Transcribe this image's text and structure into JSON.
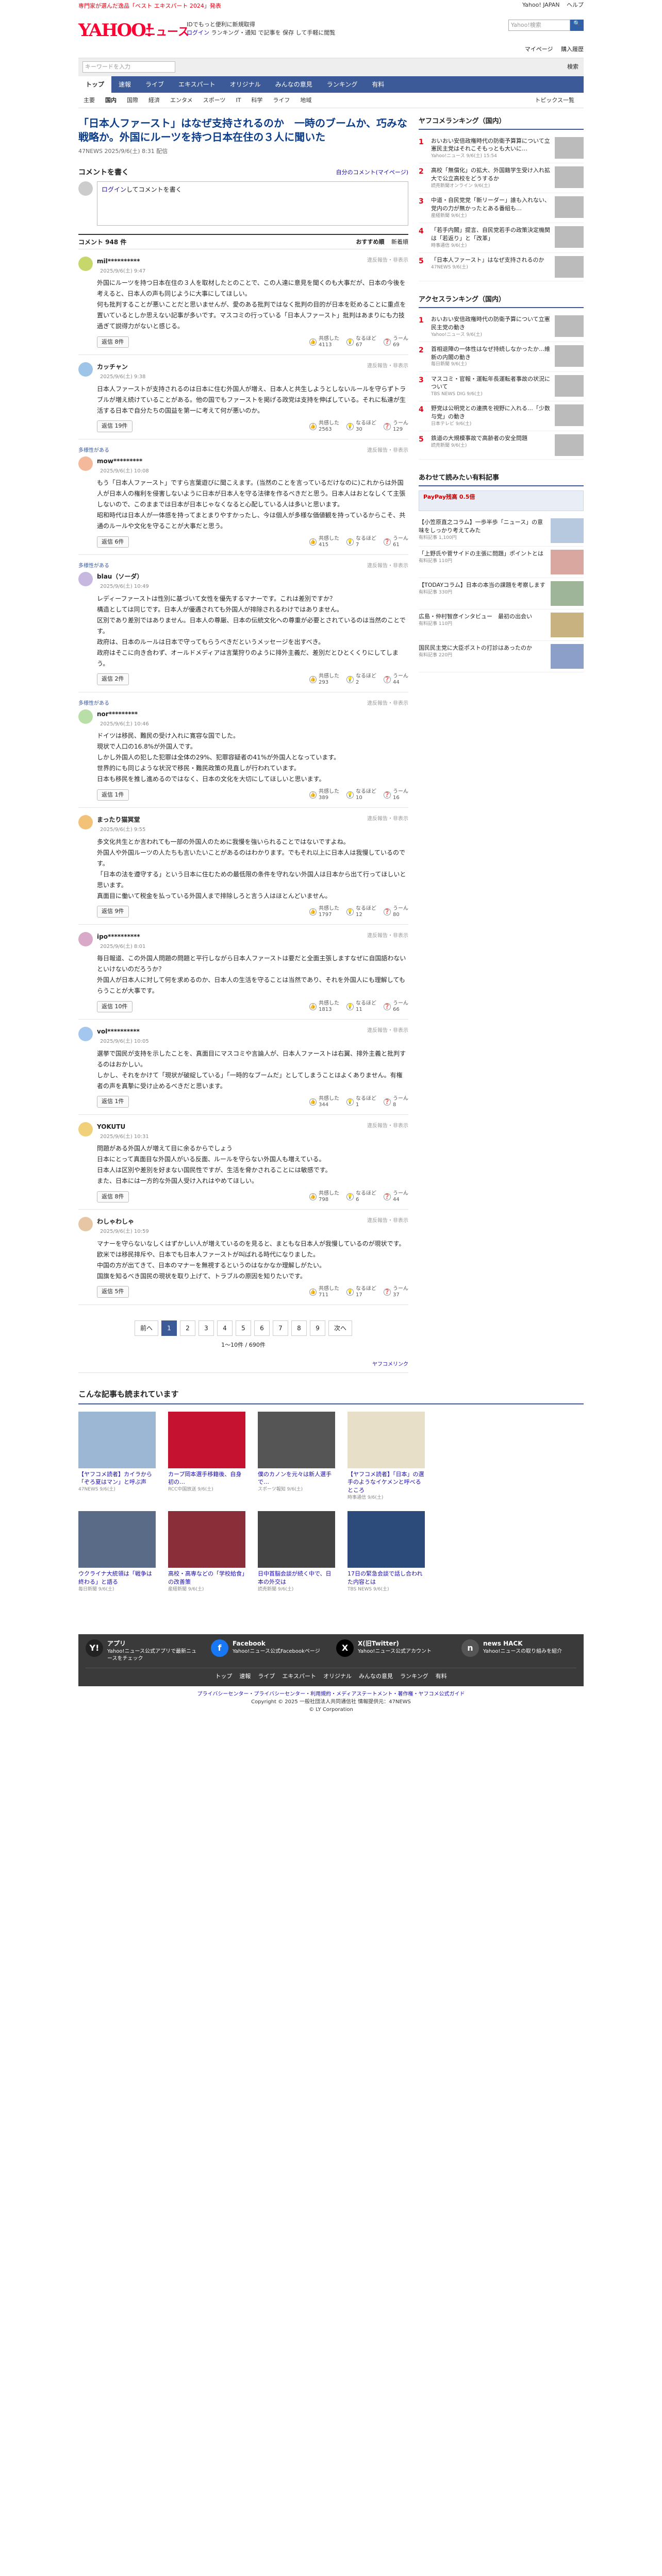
{
  "topbar": {
    "promo": "専門家が選んだ逸品「ベスト エキスパート 2024」発表",
    "links": [
      "Yahoo! JAPAN",
      "ヘルプ"
    ]
  },
  "header": {
    "logo": "YAHOO!",
    "logo_sub": "ニュース",
    "tagline": "IDでもっと便利に新規取得",
    "login": "ログイン",
    "login_note": "ランキング・通知 で記事を 保存 して手軽に閲覧",
    "search_placeholder": "Yahoo!検索",
    "mypage": "マイページ",
    "purchase": "購入履歴",
    "search_btn": "🔍"
  },
  "searchrow": {
    "placeholder": "キーワードを入力",
    "right_label": "検索"
  },
  "gnav": [
    "トップ",
    "速報",
    "ライブ",
    "エキスパート",
    "オリジナル",
    "みんなの意見",
    "ランキング",
    "有料"
  ],
  "snav": [
    "主要",
    "国内",
    "国際",
    "経済",
    "エンタメ",
    "スポーツ",
    "IT",
    "科学",
    "ライフ",
    "地域"
  ],
  "snav_topics": "トピックス一覧",
  "article": {
    "title": "「日本人ファースト」はなぜ支持されるのか　一時のブームか、巧みな戦略か。外国にルーツを持つ日本在住の３人に聞いた",
    "source": "47NEWS  2025/9/6(土) 8:31 配信"
  },
  "comment_box": {
    "header": "コメントを書く",
    "right_link": "自分のコメント(マイページ)",
    "link": "ログイン",
    "text": "してコメントを書く"
  },
  "comment_bar": {
    "label": "コメント 948 件",
    "sort_label": "おすすめ順",
    "sort_new": "新着順"
  },
  "comments": [
    {
      "pinned": "",
      "name": "mil**********",
      "date": "2025/9/6(土) 9:47",
      "report": "違反報告・非表示",
      "text": "外国にルーツを持つ日本在住の３人を取材したとのことで、この人達に意見を聞くのも大事だが、日本の今後を考えると、日本人の声も同じように大事にしてほしい。\n何も批判することが悪いことだと思いませんが、愛のある批判ではなく批判の目的が日本を貶めることに重点を置いているとしか思えない記事が多いです。マスコミの行っている「日本人ファースト」批判はあまりにも力技過ぎて説得力がないと感じる。",
      "reply": "返信 8件",
      "votes": [
        [
          "共感した",
          "4113"
        ],
        [
          "なるほど",
          "67"
        ],
        [
          "うーん",
          "69"
        ]
      ],
      "avcolor": "#c8d76b"
    },
    {
      "pinned": "",
      "name": "カッチャン",
      "date": "2025/9/6(土) 9:38",
      "report": "違反報告・非表示",
      "text": "日本人ファーストが支持されるのは日本に住む外国人が増え、日本人と共生しようとしないルールを守らずトラブルが増え続けていることがある。他の国でもファーストを掲げる政党は支持を伸ばしている。それに私達が生活する日本で自分たちの国益を第一に考えて何が悪いのか。",
      "reply": "返信 19件",
      "votes": [
        [
          "共感した",
          "2563"
        ],
        [
          "なるほど",
          "30"
        ],
        [
          "うーん",
          "129"
        ]
      ],
      "avcolor": "#9ec5e8"
    },
    {
      "pinned": "多様性がある",
      "name": "mow*********",
      "date": "2025/9/6(土) 10:08",
      "report": "違反報告・非表示",
      "text": "もう「日本人ファースト」ですら言葉遊びに聞こえます。(当然のことを言っているだけなのに)これからは外国人が日本人の権利を侵害しないように日本が日本人を守る法律を作るべきだと思う。日本人はおとなしくて主張しないので、このままでは日本が日本じゃなくなると心配している人は多いと思います。\n昭和時代は日本人が一体感を持ってまとまりやすかったし、今は個人が多様な価値観を持っているからこそ、共通のルールや文化を守ることが大事だと思う。",
      "reply": "返信 6件",
      "votes": [
        [
          "共感した",
          "415"
        ],
        [
          "なるほど",
          "7"
        ],
        [
          "うーん",
          "61"
        ]
      ],
      "avcolor": "#f4b89b"
    },
    {
      "pinned": "多様性がある",
      "name": "blau（ソーダ）",
      "date": "2025/9/6(土) 10:49",
      "report": "違反報告・非表示",
      "text": "レディーファーストは性別に基づいて女性を優先するマナーです。これは差別ですか？\n構造としては同じです。日本人が優遇されても外国人が排除されるわけではありません。\n区別であり差別ではありません。日本人の尊厳、日本の伝統文化への尊重が必要とされているのは当然のことです。\n政府は、日本のルールは日本で守ってもらうべきだというメッセージを出すべき。\n政府はそこに向き合わず、オールドメディアは言葉狩りのように排外主義だ、差別だとひとくくりにしてしまう。",
      "reply": "返信 2件",
      "votes": [
        [
          "共感した",
          "293"
        ],
        [
          "なるほど",
          "2"
        ],
        [
          "うーん",
          "44"
        ]
      ],
      "avcolor": "#c7b8e0"
    },
    {
      "pinned": "多様性がある",
      "name": "nor*********",
      "date": "2025/9/6(土) 10:46",
      "report": "違反報告・非表示",
      "text": "ドイツは移民、難民の受け入れに寛容な国でした。\n現状で人口の16.8%が外国人です。\nしかし外国人の犯した犯罪は全体の29%、犯罪容疑者の41%が外国人となっています。\n世界的にも同じような状況で移民・難民政策の見直しが行われています。\n日本も移民を推し進めるのではなく、日本の文化を大切にしてほしいと思います。",
      "reply": "返信 1件",
      "votes": [
        [
          "共感した",
          "389"
        ],
        [
          "なるほど",
          "10"
        ],
        [
          "うーん",
          "16"
        ]
      ],
      "avcolor": "#b9dfa8"
    },
    {
      "pinned": "",
      "name": "まったり猫冥堂",
      "date": "2025/9/6(土) 9:55",
      "report": "違反報告・非表示",
      "text": "多文化共生とか言われても一部の外国人のために我慢を強いられることではないですよね。\n外国人や外国ルーツの人たちも言いたいことがあるのはわかります。でもそれ以上に日本人は我慢しているのです。\n「日本の法を遵守する」という日本に住むための最低限の条件を守れない外国人は日本から出て行ってほしいと思います。\n真面目に働いて税金を払っている外国人まで排除しろと言う人はほとんどいません。",
      "reply": "返信 9件",
      "votes": [
        [
          "共感した",
          "1797"
        ],
        [
          "なるほど",
          "12"
        ],
        [
          "うーん",
          "80"
        ]
      ],
      "avcolor": "#f2c279"
    },
    {
      "pinned": "",
      "name": "ipo**********",
      "date": "2025/9/6(土) 8:01",
      "report": "違反報告・非表示",
      "text": "毎日報道、この外国人問題の問題と平行しながら日本人ファーストは要だと全面主張しますなぜに自国語わないといけないのだろうか？\n外国人が日本人に対して何を求めるのか、日本人の生活を守ることは当然であり、それを外国人にも理解してもらうことが大事です。",
      "reply": "返信 10件",
      "votes": [
        [
          "共感した",
          "1813"
        ],
        [
          "なるほど",
          "11"
        ],
        [
          "うーん",
          "66"
        ]
      ],
      "avcolor": "#d8a9c9"
    },
    {
      "pinned": "",
      "name": "vol**********",
      "date": "2025/9/6(土) 10:05",
      "report": "違反報告・非表示",
      "text": "選挙で国民が支持を示したことを、真面目にマスコミや言論人が、日本人ファーストは右翼、排外主義と批判するのはおかしい。\nしかし、それをかけて「現状が破綻している」「一時的なブームだ」としてしまうことはよくありません。有権者の声を真摯に受け止めるべきだと思います。",
      "reply": "返信 1件",
      "votes": [
        [
          "共感した",
          "344"
        ],
        [
          "なるほど",
          "1"
        ],
        [
          "うーん",
          "8"
        ]
      ],
      "avcolor": "#a3c7ee"
    },
    {
      "pinned": "",
      "name": "YOKUTU",
      "date": "2025/9/6(土) 10:31",
      "report": "違反報告・非表示",
      "text": "問題がある外国人が増えて目に余るからでしょう\n日本にとって真面目な外国人がいる反面、ルールを守らない外国人も増えている。\n日本人は区別や差別を好まない国民性ですが、生活を脅かされることには敏感です。\nまた、日本には一方的な外国人受け入れはやめてほしい。",
      "reply": "返信 8件",
      "votes": [
        [
          "共感した",
          "798"
        ],
        [
          "なるほど",
          "6"
        ],
        [
          "うーん",
          "44"
        ]
      ],
      "avcolor": "#f0d078"
    },
    {
      "pinned": "",
      "name": "わしゃわしゃ",
      "date": "2025/9/6(土) 10:59",
      "report": "違反報告・非表示",
      "text": "マナーを守らないなしくはずかしい人が増えているのを見ると、まともな日本人が我慢しているのが現状です。\n欧米では移民排斥や、日本でも日本人ファーストが叫ばれる時代になりました。\n中国の方が出てきて、日本のマナーを無視するというのはなかなか理解しがたい。\n国旗を知るべき国民の現状を取り上げて、トラブルの原因を知りたいです。",
      "reply": "返信 5件",
      "votes": [
        [
          "共感した",
          "711"
        ],
        [
          "なるほど",
          "17"
        ],
        [
          "うーん",
          "37"
        ]
      ],
      "avcolor": "#e7c6a5"
    }
  ],
  "pager": {
    "prev": "前へ",
    "pages": [
      "1",
      "2",
      "3",
      "4",
      "5",
      "6",
      "7",
      "8",
      "9"
    ],
    "next": "次へ",
    "count": "1〜10件 / 690件",
    "yahoo_link": "ヤフコメリンク"
  },
  "right": {
    "ranking_title": "ヤフコメランキング（国内）",
    "ranking": [
      {
        "num": "1",
        "text": "おいおい安倍政権時代の防衛予算算について立憲民主党はそれこそもっとも大いに…",
        "meta": "Yahoo!ニュース 9/6(土) 15:54"
      },
      {
        "num": "2",
        "text": "高校「無償化」の拡大、外国籍学生受け入れ拡大で公立高校をどうするか",
        "meta": "読売新聞オンライン 9/6(土)"
      },
      {
        "num": "3",
        "text": "中道・自民党党「新リーダー」誰も入れない、党内の力が無かったとある番組も…",
        "meta": "産経新聞 9/6(土)"
      },
      {
        "num": "4",
        "text": "「若手内閣」提言、自民党若手の政策決定機関は「若返り」と「改革」",
        "meta": "時事通信 9/6(土)"
      },
      {
        "num": "5",
        "text": "「日本人ファースト」はなぜ支持されるのか",
        "meta": "47NEWS 9/6(土)"
      }
    ],
    "access_title": "アクセスランキング（国内）",
    "access": [
      {
        "num": "1",
        "text": "おいおい安倍政権時代の防衛予算について立憲民主党の動き",
        "meta": "Yahoo!ニュース 9/6(土)"
      },
      {
        "num": "2",
        "text": "首相退陣の一体性はなぜ持続しなかったか…維新の内閣の動き",
        "meta": "毎日新聞 9/6(土)"
      },
      {
        "num": "3",
        "text": "マスコミ・官報・運転年長運転者事故の状況について",
        "meta": "TBS NEWS DIG 9/6(土)"
      },
      {
        "num": "4",
        "text": "野党は公明党との連携を視野に入れる…「少数与党」の動き",
        "meta": "日本テレビ 9/6(土)"
      },
      {
        "num": "5",
        "text": "鉄道の大規模事故で高齢者の安全問題",
        "meta": "読売新聞 9/6(土)"
      }
    ],
    "ad_title": "あわせて読みたい有料記事",
    "ad_banner": "PayPay残高 0.5倍",
    "ads": [
      {
        "text": "【小笠原直之コラム】一歩半歩「ニュース」の意味をしっかり考えてみた",
        "meta": "有料記事 1,100円"
      },
      {
        "text": "「上野氏や菅サイドの主張に問題」ポイントとは",
        "meta": "有料記事 110円"
      },
      {
        "text": "【TODAYコラム】日本の本当の課題を考察します",
        "meta": "有料記事 330円"
      },
      {
        "text": "広島・仲村智彦インタビュー　最初の出会い",
        "meta": "有料記事 110円"
      },
      {
        "text": "国民民主党に大臣ポストの打診はあったのか",
        "meta": "有料記事 220円"
      }
    ]
  },
  "recs": {
    "title": "こんな記事も読まれています",
    "items": [
      {
        "t": "【ヤフコメ読者】カイラから「ぞろ夏はマン」と呼ぶ声",
        "m": "47NEWS 9/6(土)",
        "c": "#9bb7d4"
      },
      {
        "t": "カープ岡本選手移籍後、自身初の…",
        "m": "RCC中国放送 9/6(土)",
        "c": "#c41230"
      },
      {
        "t": "僕のカノンを元々は新人選手で…",
        "m": "スポーツ報知 9/6(土)",
        "c": "#555"
      },
      {
        "t": "【ヤフコメ読者】「日本」の選手のようなイケメンと呼べるところ",
        "m": "時事通信 9/6(土)",
        "c": "#e8dfc8"
      },
      {
        "t": "ウクライナ大統領は「戦争は終わる」と語る",
        "m": "毎日新聞 9/6(土)",
        "c": "#5a6b88"
      },
      {
        "t": "高校・高専などの「学校給食」の改善策",
        "m": "産経新聞 9/6(土)",
        "c": "#8a2e3a"
      },
      {
        "t": "日中首脳会談が続く中で、日本の外交は",
        "m": "読売新聞 9/6(土)",
        "c": "#444"
      },
      {
        "t": "17日の緊急会談で話し合われた内容とは",
        "m": "TBS NEWS 9/6(土)",
        "c": "#2c4a7a"
      }
    ]
  },
  "footer": {
    "social": [
      {
        "title": "アプリ",
        "text": "Yahoo!ニュース公式アプリで最新ニュースをチェック",
        "color": "#222",
        "glyph": "Y!"
      },
      {
        "title": "Facebook",
        "text": "Yahoo!ニュース公式Facebookページ",
        "color": "#1877f2",
        "glyph": "f"
      },
      {
        "title": "X(旧Twitter)",
        "text": "Yahoo!ニュース公式アカウント",
        "color": "#000",
        "glyph": "X"
      },
      {
        "title": "news HACK",
        "text": "Yahoo!ニュースの取り組みを紹介",
        "color": "#555",
        "glyph": "n"
      }
    ],
    "nav": [
      "トップ",
      "速報",
      "ライブ",
      "エキスパート",
      "オリジナル",
      "みんなの意見",
      "ランキング",
      "有料"
    ],
    "links": "プライバシーセンター・プライバシーセンター・利用規約・メディアステートメント・著作権・ヤフコメ公式ガイド",
    "copyright": "Copyright © 2025 一般社団法人共同通信社 情報提供元：47NEWS",
    "corp": "© LY Corporation"
  }
}
